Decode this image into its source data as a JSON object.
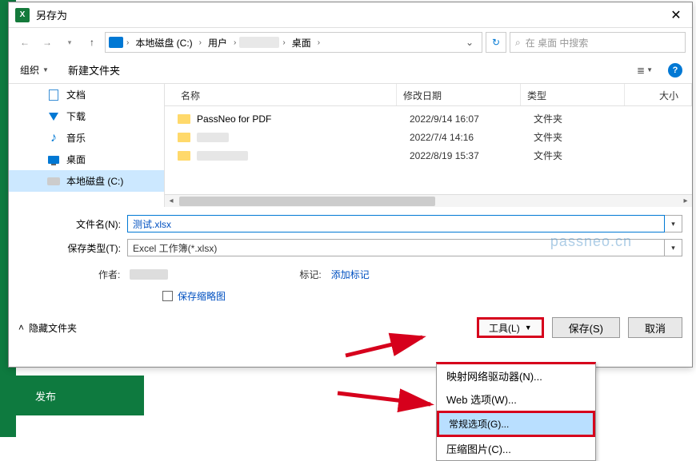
{
  "title": "另存为",
  "bg_publish": "发布",
  "nav": {
    "path_segs": [
      "本地磁盘 (C:)",
      "用户",
      "桌面"
    ],
    "search_placeholder": "在 桌面 中搜索"
  },
  "toolbar": {
    "organize": "组织",
    "newfolder": "新建文件夹"
  },
  "sidebar": {
    "items": [
      {
        "label": "文档"
      },
      {
        "label": "下载"
      },
      {
        "label": "音乐"
      },
      {
        "label": "桌面"
      },
      {
        "label": "本地磁盘 (C:)"
      }
    ]
  },
  "columns": {
    "name": "名称",
    "date": "修改日期",
    "type": "类型",
    "size": "大小"
  },
  "rows": [
    {
      "name": "PassNeo for PDF",
      "date": "2022/9/14 16:07",
      "type": "文件夹"
    },
    {
      "name": "",
      "date": "2022/7/4 14:16",
      "type": "文件夹"
    },
    {
      "name": "",
      "date": "2022/8/19 15:37",
      "type": "文件夹"
    }
  ],
  "form": {
    "filename_label": "文件名(N):",
    "filename_value": "测试.xlsx",
    "filetype_label": "保存类型(T):",
    "filetype_value": "Excel 工作簿(*.xlsx)",
    "author_label": "作者:",
    "tag_label": "标记:",
    "tag_add": "添加标记",
    "thumbnail": "保存缩略图"
  },
  "footer": {
    "hide": "隐藏文件夹",
    "tools": "工具(L)",
    "save": "保存(S)",
    "cancel": "取消"
  },
  "dropdown": {
    "items": [
      "映射网络驱动器(N)...",
      "Web 选项(W)...",
      "常规选项(G)...",
      "压缩图片(C)..."
    ]
  },
  "watermark": "passneo.cn"
}
